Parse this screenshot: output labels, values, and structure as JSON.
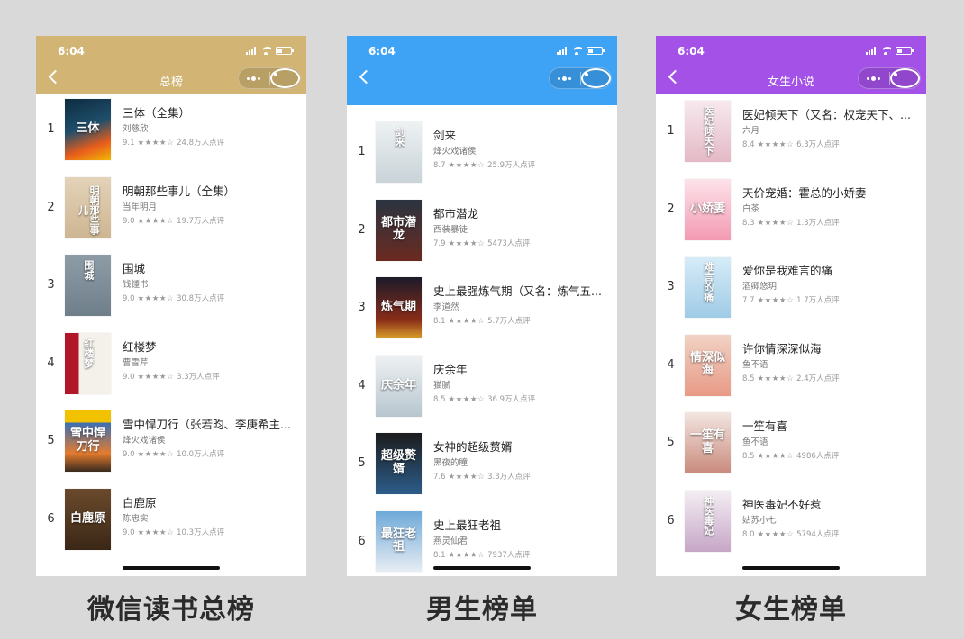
{
  "panels": [
    {
      "time": "6:04",
      "nav_title": "总榜",
      "header_color": "#d2b574",
      "caption": "微信读书总榜",
      "items": [
        {
          "rank": "1",
          "title": "三体（全集）",
          "author": "刘慈欣",
          "score": "9.1",
          "stars": "★★★★☆",
          "reviews": "24.8万人点评",
          "cover_bg": "linear-gradient(160deg,#0d2b3e,#1f4e6b 45%,#e85d1c 75%,#f2b705)",
          "cover_text": "三体",
          "vertical": false
        },
        {
          "rank": "2",
          "title": "明朝那些事儿（全集）",
          "author": "当年明月",
          "score": "9.0",
          "stars": "★★★★☆",
          "reviews": "19.7万人点评",
          "cover_bg": "linear-gradient(180deg,#e3d3b8,#cdb592)",
          "cover_text": "明朝那些事儿",
          "vertical": true
        },
        {
          "rank": "3",
          "title": "围城",
          "author": "钱锺书",
          "score": "9.0",
          "stars": "★★★★☆",
          "reviews": "30.8万人点评",
          "cover_bg": "linear-gradient(180deg,#8e9ca6,#6f7f8a)",
          "cover_text": "围城",
          "vertical": true
        },
        {
          "rank": "4",
          "title": "红楼梦",
          "author": "曹雪芹",
          "score": "9.0",
          "stars": "★★★★☆",
          "reviews": "3.3万人点评",
          "cover_bg": "linear-gradient(90deg,#b0182a 30%,#f4f0ea 30%)",
          "cover_text": "红楼梦",
          "vertical": true
        },
        {
          "rank": "5",
          "title": "雪中悍刀行（张若昀、李庚希主...",
          "author": "烽火戏诸侯",
          "score": "9.0",
          "stars": "★★★★☆",
          "reviews": "10.0万人点评",
          "cover_bg": "linear-gradient(180deg,#f2c200 20%,#3b6fb5 20%,#e37b2e 70%,#3a2a1e)",
          "cover_text": "雪中悍刀行",
          "vertical": false
        },
        {
          "rank": "6",
          "title": "白鹿原",
          "author": "陈忠实",
          "score": "9.0",
          "stars": "★★★★☆",
          "reviews": "10.3万人点评",
          "cover_bg": "linear-gradient(180deg,#6b4a2c,#3a2716)",
          "cover_text": "白鹿原",
          "vertical": false
        }
      ]
    },
    {
      "time": "6:04",
      "nav_title": "",
      "header_color": "#3ea3f5",
      "caption": "男生榜单",
      "items": [
        {
          "rank": "1",
          "title": "剑来",
          "author": "烽火戏诸侯",
          "score": "8.7",
          "stars": "★★★★☆",
          "reviews": "25.9万人点评",
          "cover_bg": "linear-gradient(180deg,#eef2f3,#c9d3d8)",
          "cover_text": "剑来",
          "vertical": true
        },
        {
          "rank": "2",
          "title": "都市潜龙",
          "author": "西装暴徒",
          "score": "7.9",
          "stars": "★★★★☆",
          "reviews": "5473人点评",
          "cover_bg": "linear-gradient(180deg,#2a3440,#6b2a20)",
          "cover_text": "都市潜龙",
          "vertical": false
        },
        {
          "rank": "3",
          "title": "史上最强炼气期（又名：炼气五...",
          "author": "李道然",
          "score": "8.1",
          "stars": "★★★★☆",
          "reviews": "5.7万人点评",
          "cover_bg": "linear-gradient(180deg,#1b1b2a,#8a2c18 70%,#d9a02b)",
          "cover_text": "炼气期",
          "vertical": false
        },
        {
          "rank": "4",
          "title": "庆余年",
          "author": "猫腻",
          "score": "8.5",
          "stars": "★★★★☆",
          "reviews": "36.9万人点评",
          "cover_bg": "linear-gradient(180deg,#eef1f3,#b8c6cf)",
          "cover_text": "庆余年",
          "vertical": false
        },
        {
          "rank": "5",
          "title": "女神的超级赘婿",
          "author": "黑夜的瞳",
          "score": "7.6",
          "stars": "★★★★☆",
          "reviews": "3.3万人点评",
          "cover_bg": "linear-gradient(180deg,#1c1c1c,#2c5c8a)",
          "cover_text": "超级赘婿",
          "vertical": false
        },
        {
          "rank": "6",
          "title": "史上最狂老祖",
          "author": "燕灵仙君",
          "score": "8.1",
          "stars": "★★★★☆",
          "reviews": "7937人点评",
          "cover_bg": "linear-gradient(180deg,#6ea9d8,#e9eef4)",
          "cover_text": "最狂老祖",
          "vertical": false
        }
      ]
    },
    {
      "time": "6:04",
      "nav_title": "女生小说",
      "header_color": "#a451e8",
      "caption": "女生榜单",
      "items": [
        {
          "rank": "1",
          "title": "医妃倾天下（又名：权宠天下、...",
          "author": "六月",
          "score": "8.4",
          "stars": "★★★★☆",
          "reviews": "6.3万人点评",
          "cover_bg": "linear-gradient(180deg,#f7e9ee,#e4b9c6)",
          "cover_text": "医妃倾天下",
          "vertical": true
        },
        {
          "rank": "2",
          "title": "天价宠婚：霍总的小娇妻",
          "author": "白茶",
          "score": "8.3",
          "stars": "★★★★☆",
          "reviews": "1.3万人点评",
          "cover_bg": "linear-gradient(180deg,#fde3ea,#f39ab2)",
          "cover_text": "小娇妻",
          "vertical": false
        },
        {
          "rank": "3",
          "title": "爱你是我难言的痛",
          "author": "酒卿悠玥",
          "score": "7.7",
          "stars": "★★★★☆",
          "reviews": "1.7万人点评",
          "cover_bg": "linear-gradient(180deg,#d7ecf8,#9fcbe6)",
          "cover_text": "难言的痛",
          "vertical": true
        },
        {
          "rank": "4",
          "title": "许你情深深似海",
          "author": "鱼不语",
          "score": "8.5",
          "stars": "★★★★☆",
          "reviews": "2.4万人点评",
          "cover_bg": "linear-gradient(180deg,#f1d2c4,#e89a86)",
          "cover_text": "情深似海",
          "vertical": false
        },
        {
          "rank": "5",
          "title": "一笙有喜",
          "author": "鱼不语",
          "score": "8.5",
          "stars": "★★★★☆",
          "reviews": "4986人点评",
          "cover_bg": "linear-gradient(180deg,#f3e6e1,#c98a7c)",
          "cover_text": "一笙有喜",
          "vertical": false
        },
        {
          "rank": "6",
          "title": "神医毒妃不好惹",
          "author": "姑苏小七",
          "score": "8.0",
          "stars": "★★★★☆",
          "reviews": "5794人点评",
          "cover_bg": "linear-gradient(180deg,#f4eef3,#c6a6c6)",
          "cover_text": "神医毒妃",
          "vertical": true
        }
      ]
    }
  ],
  "icons": {
    "back": "chevron-left-icon",
    "more": "more-dots-icon",
    "close": "target-close-icon",
    "signal": "signal-icon",
    "wifi": "wifi-icon",
    "battery": "battery-icon"
  }
}
